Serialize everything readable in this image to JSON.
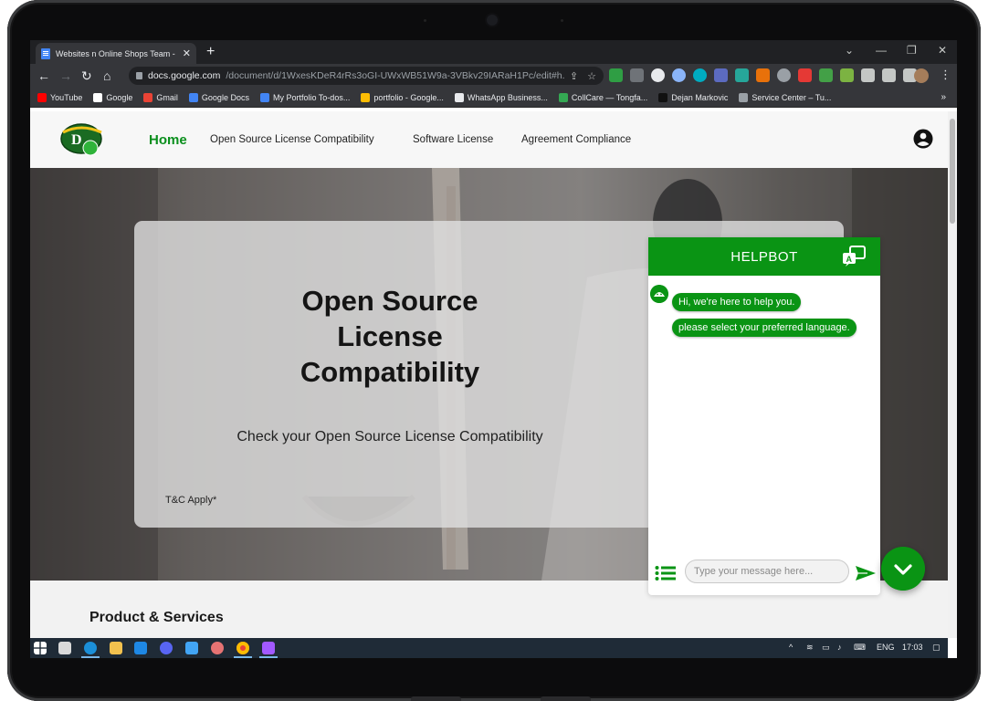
{
  "browser": {
    "tab_title": "Websites n Online Shops Team -",
    "tab_close": "✕",
    "new_tab": "+",
    "url_host": "docs.google.com",
    "url_path": "/document/d/1WxesKDeR4rRs3oGI-UWxWB51W9a-3VBkv29IARaH1Pc/edit#h...",
    "bookmarks": [
      {
        "label": "YouTube",
        "color": "#ff0000"
      },
      {
        "label": "Google",
        "color": "#ffffff"
      },
      {
        "label": "Gmail",
        "color": "#ea4335"
      },
      {
        "label": "Google Docs",
        "color": "#4285f4"
      },
      {
        "label": "My Portfolio To-dos...",
        "color": "#4285f4"
      },
      {
        "label": "portfolio - Google...",
        "color": "#fbbc04"
      },
      {
        "label": "WhatsApp Business...",
        "color": "#e8eaed"
      },
      {
        "label": "CollCare — Tongfa...",
        "color": "#34a853"
      },
      {
        "label": "Dejan Markovic",
        "color": "#111111"
      },
      {
        "label": "Service Center – Tu...",
        "color": "#9aa0a6"
      }
    ],
    "bookmarks_more": "»"
  },
  "site": {
    "nav": {
      "home": "Home",
      "links": [
        "Open Source License Compatibility",
        "Software License",
        "Agreement Compliance"
      ]
    },
    "hero": {
      "title_lines": [
        "Open Source",
        "License",
        "Compatibility"
      ],
      "subtitle": "Check your Open Source License Compatibility",
      "tc": "T&C Apply*"
    },
    "section_title": "Product & Services"
  },
  "helpbot": {
    "title": "HELPBOT",
    "messages": [
      "Hi, we're here to help you.",
      "please select your preferred language."
    ],
    "input_placeholder": "Type your message here..."
  },
  "taskbar": {
    "lang": "ENG",
    "time": "17:03"
  },
  "colors": {
    "brand_green": "#0a9414",
    "home_green": "#0a8f1d"
  }
}
